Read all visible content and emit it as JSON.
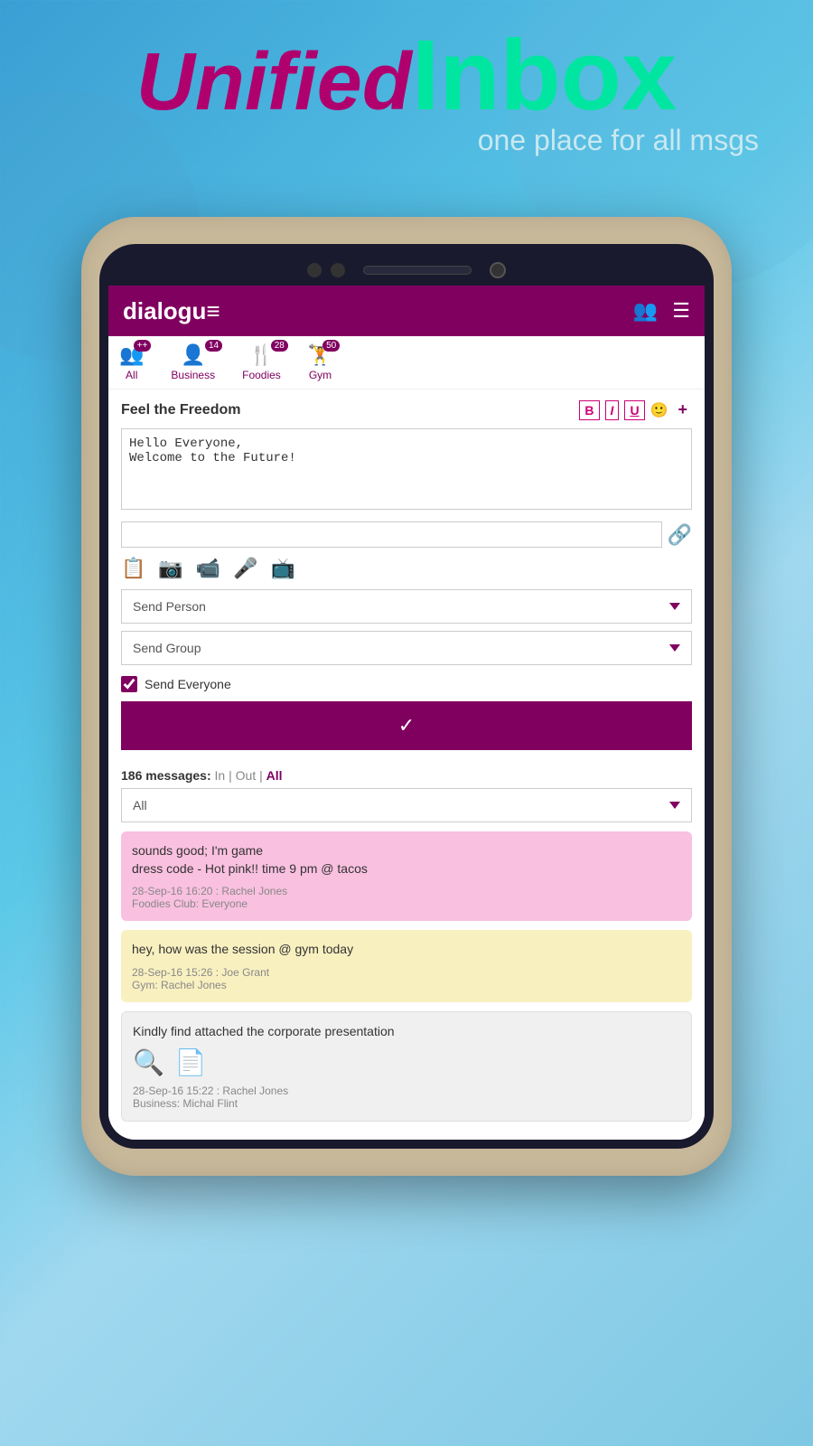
{
  "header": {
    "unified_label": "Unified",
    "inbox_label": "Inbox",
    "subtitle": "one place for all msgs"
  },
  "app": {
    "logo": "dialogu≡",
    "header_icons": [
      "group-icon",
      "menu-icon"
    ]
  },
  "nav_tabs": [
    {
      "icon": "👥",
      "label": "All",
      "badge": "++",
      "id": "all"
    },
    {
      "icon": "👤",
      "label": "Business",
      "badge": "14",
      "id": "business"
    },
    {
      "icon": "🍴",
      "label": "Foodies",
      "badge": "28",
      "id": "foodies"
    },
    {
      "icon": "🏋",
      "label": "Gym",
      "badge": "50",
      "id": "gym"
    }
  ],
  "compose": {
    "section_title": "Feel the Freedom",
    "format_buttons": [
      "B",
      "I",
      "U"
    ],
    "message_text": "Hello Everyone,\nWelcome to the Future!",
    "link_placeholder": "",
    "send_person_label": "Send Person",
    "send_group_label": "Send Group",
    "send_everyone_label": "Send Everyone",
    "send_button_label": "✓"
  },
  "messages": {
    "count_label": "186 messages:",
    "filter_in": "In",
    "filter_out": "Out",
    "filter_all": "All",
    "filter_dropdown_value": "All",
    "items": [
      {
        "id": "msg1",
        "text": "sounds good; I'm game\ndress code - Hot pink!! time 9 pm @ tacos",
        "date": "28-Sep-16",
        "time": "16:20",
        "sender": "Rachel Jones",
        "group": "Foodies Club: Everyone",
        "color": "pink"
      },
      {
        "id": "msg2",
        "text": "hey, how was the session @ gym today",
        "date": "28-Sep-16",
        "time": "15:26",
        "sender": "Joe Grant",
        "group": "Gym: Rachel Jones",
        "color": "yellow"
      },
      {
        "id": "msg3",
        "text": "Kindly find attached the corporate presentation",
        "date": "28-Sep-16",
        "time": "15:22",
        "sender": "Rachel Jones",
        "group": "Business: Michal Flint",
        "color": "white",
        "has_attachments": true
      }
    ]
  }
}
